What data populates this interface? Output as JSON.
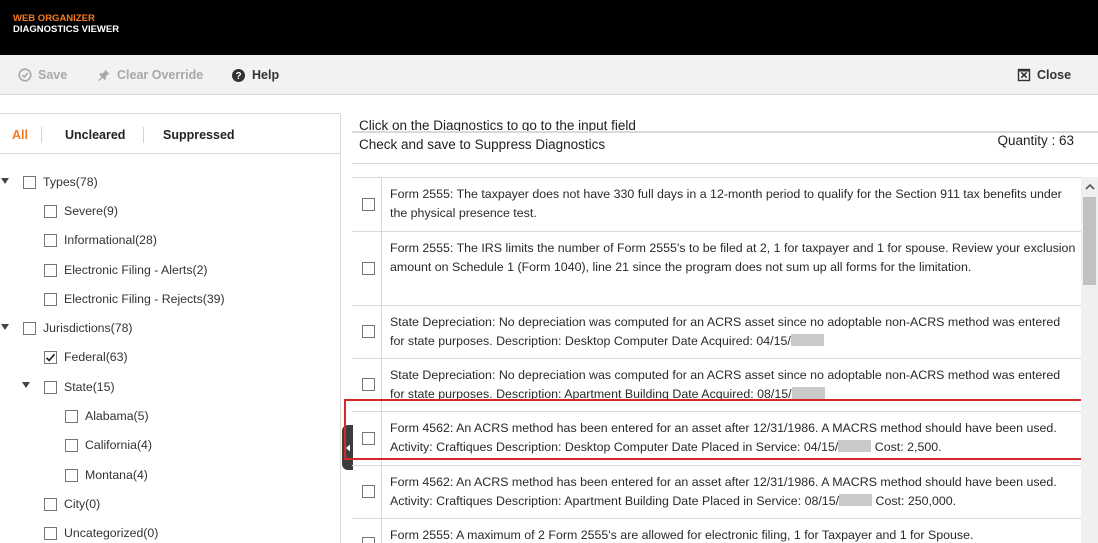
{
  "app": {
    "brand_line1": "WEB ORGANIZER",
    "brand_line2": "DIAGNOSTICS VIEWER",
    "accent_color": "#f47b20"
  },
  "toolbar": {
    "save_label": "Save",
    "clear_override_label": "Clear Override",
    "help_label": "Help",
    "close_label": "Close"
  },
  "filters": {
    "all": "All",
    "uncleared": "Uncleared",
    "suppressed": "Suppressed",
    "selected": "All"
  },
  "tree": {
    "types": "Types(78)",
    "severe": "Severe(9)",
    "informational": "Informational(28)",
    "ef_alerts": "Electronic Filing - Alerts(2)",
    "ef_rejects": "Electronic Filing - Rejects(39)",
    "jurisdictions": "Jurisdictions(78)",
    "federal": "Federal(63)",
    "state": "State(15)",
    "alabama": "Alabama(5)",
    "california": "California(4)",
    "montana": "Montana(4)",
    "city": "City(0)",
    "uncategorized": "Uncategorized(0)"
  },
  "info": {
    "line1": "Click on the Diagnostics to go to the input field",
    "line2": "Check and save to Suppress Diagnostics",
    "quantity": "Quantity : 63"
  },
  "diagnostics": [
    {
      "text": "Form 2555: The taxpayer does not have 330 full days in a 12-month period to qualify for the Section 911 tax benefits under the physical presence test."
    },
    {
      "text": "Form 2555: The IRS limits the number of Form 2555's to be filed at 2, 1 for taxpayer and 1 for spouse. Review your exclusion amount on Schedule 1 (Form 1040), line 21 since the program does not sum up all forms for the limitation."
    },
    {
      "text": "State Depreciation: No depreciation was computed for an ACRS asset since no adoptable non-ACRS method was entered for state purposes. Description: Desktop Computer Date Acquired: 04/15/"
    },
    {
      "text": "State Depreciation: No depreciation was computed for an ACRS asset since no adoptable non-ACRS method was entered for state purposes. Description: Apartment Building Date Acquired: 08/15/"
    },
    {
      "text_a": "Form 4562: An ACRS method has been entered for an asset after 12/31/1986. A MACRS method should have been used. Activity: Craftiques Description: Desktop Computer Date Placed in Service: 04/15/",
      "text_b": " Cost: 2,500."
    },
    {
      "text_a": "Form 4562: An ACRS method has been entered for an asset after 12/31/1986. A MACRS method should have been used. Activity: Craftiques Description: Apartment Building Date Placed in Service: 08/15/",
      "text_b": " Cost: 250,000."
    },
    {
      "text": "Form 2555: A maximum of 2 Form 2555's are allowed for electronic filing, 1 for Taxpayer and 1 for Spouse."
    }
  ]
}
